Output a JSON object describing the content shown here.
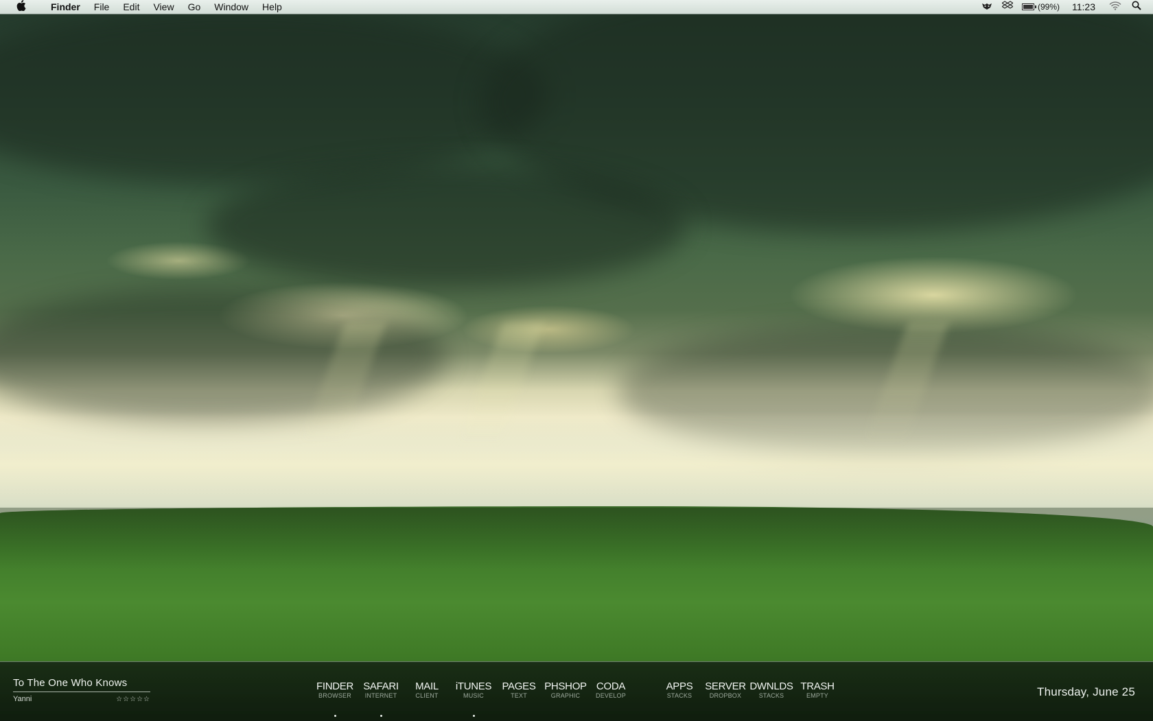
{
  "menubar": {
    "apple": "",
    "app_name": "Finder",
    "items": [
      "File",
      "Edit",
      "View",
      "Go",
      "Window",
      "Help"
    ],
    "status": {
      "battery_text": "(99%)",
      "battery_level": 0.99,
      "clock": "11:23",
      "icons": [
        "growl-icon",
        "dropbox-icon",
        "battery-icon",
        "wifi-icon",
        "spotlight-icon"
      ]
    }
  },
  "now_playing": {
    "title": "To The One Who Knows",
    "artist": "Yanni",
    "rating": "☆☆☆☆☆"
  },
  "dock": [
    {
      "label": "FINDER",
      "sub": "BROWSER"
    },
    {
      "label": "SAFARI",
      "sub": "INTERNET"
    },
    {
      "label": "MAIL",
      "sub": "CLIENT"
    },
    {
      "label": "iTUNES",
      "sub": "MUSIC"
    },
    {
      "label": "PAGES",
      "sub": "TEXT"
    },
    {
      "label": "PHSHOP",
      "sub": "GRAPHIC"
    },
    {
      "label": "CODA",
      "sub": "DEVELOP"
    },
    {
      "label": "APPS",
      "sub": "STACKS"
    },
    {
      "label": "SERVER",
      "sub": "DROPBOX"
    },
    {
      "label": "DWNLDS",
      "sub": "STACKS"
    },
    {
      "label": "TRASH",
      "sub": "EMPTY"
    }
  ],
  "date": "Thursday, June 25"
}
